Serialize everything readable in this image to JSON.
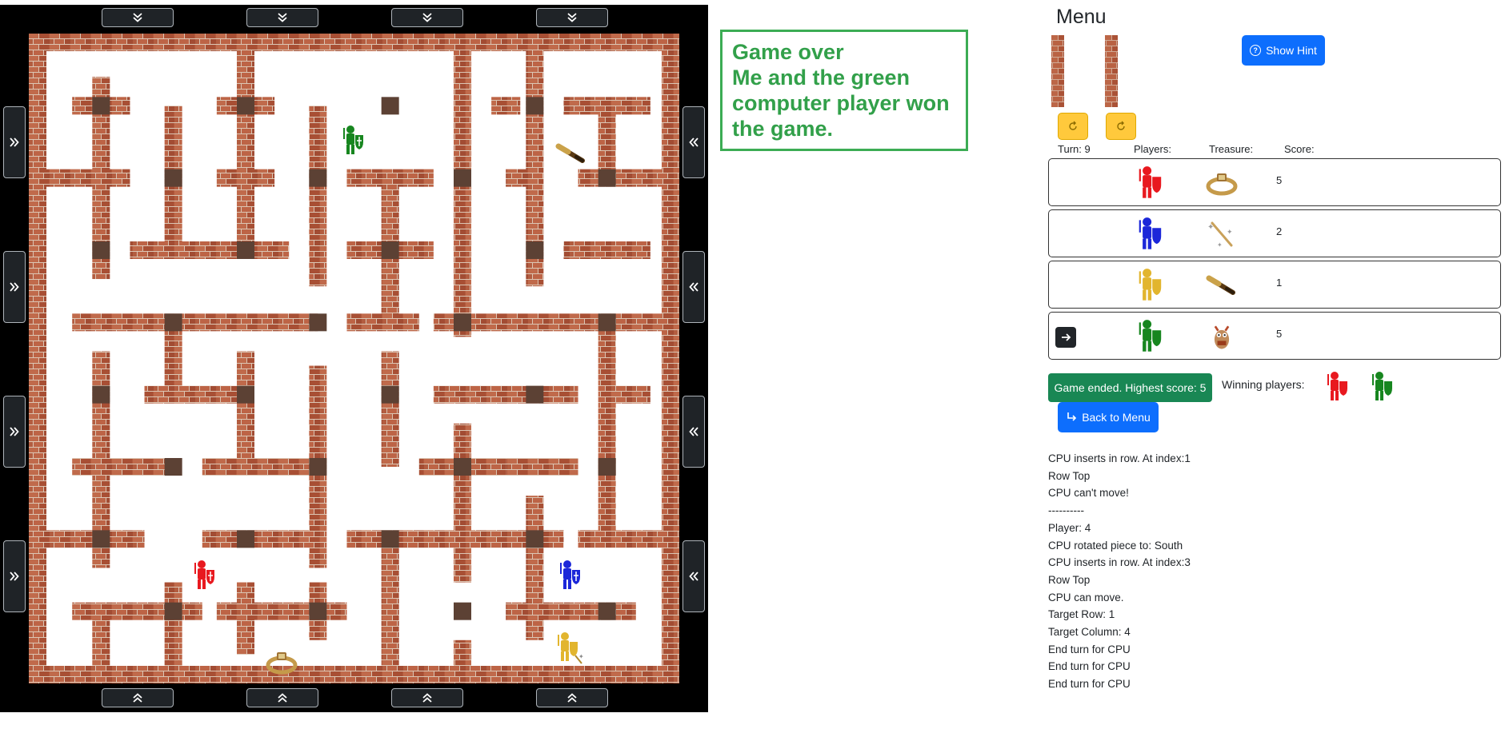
{
  "game_over": {
    "lines": [
      "Game over",
      "Me and the green",
      "computer player won",
      "the game."
    ]
  },
  "menu": {
    "title": "Menu",
    "show_hint_label": "Show Hint",
    "back_to_menu_label": "Back to Menu"
  },
  "table": {
    "turn_label": "Turn: 9",
    "players_header": "Players:",
    "treasure_header": "Treasure:",
    "score_header": "Score:",
    "rows": [
      {
        "player": "red",
        "treasure": "ring",
        "score": "5",
        "active": false
      },
      {
        "player": "blue",
        "treasure": "magic-wand",
        "score": "2",
        "active": false
      },
      {
        "player": "yellow",
        "treasure": "spyglass",
        "score": "1",
        "active": false
      },
      {
        "player": "green",
        "treasure": "owl-amulet",
        "score": "5",
        "active": true
      }
    ]
  },
  "result": {
    "game_ended": "Game ended. Highest score: 5",
    "winning_label": "Winning players:",
    "winners": [
      "red",
      "green"
    ]
  },
  "log": [
    "CPU inserts in row. At index:1",
    "Row Top",
    "CPU can't move!",
    "----------",
    "Player: 4",
    "CPU rotated piece to: South",
    "CPU inserts in row. At index:3",
    "Row Top",
    "CPU can move.",
    "Target Row: 1",
    "Target Column: 4",
    "End turn for CPU",
    "End turn for CPU",
    "End turn for CPU"
  ],
  "colors": {
    "red": "#e8191f",
    "blue": "#1c27d9",
    "yellow": "#e2b52e",
    "green": "#17861f",
    "brick": "#b4593c",
    "brick_dark": "#5c4134",
    "success": "#198754",
    "primary": "#0d6efd",
    "gameover_text": "#32a04a"
  },
  "icons": {
    "shift_down": "double-chevron-down-icon",
    "shift_up": "double-chevron-up-icon",
    "shift_right": "double-chevron-right-icon",
    "shift_left": "double-chevron-left-icon",
    "rotate": "rotate-icon",
    "hint": "question-circle-icon",
    "back": "return-arrow-icon",
    "active": "arrow-right-icon"
  }
}
